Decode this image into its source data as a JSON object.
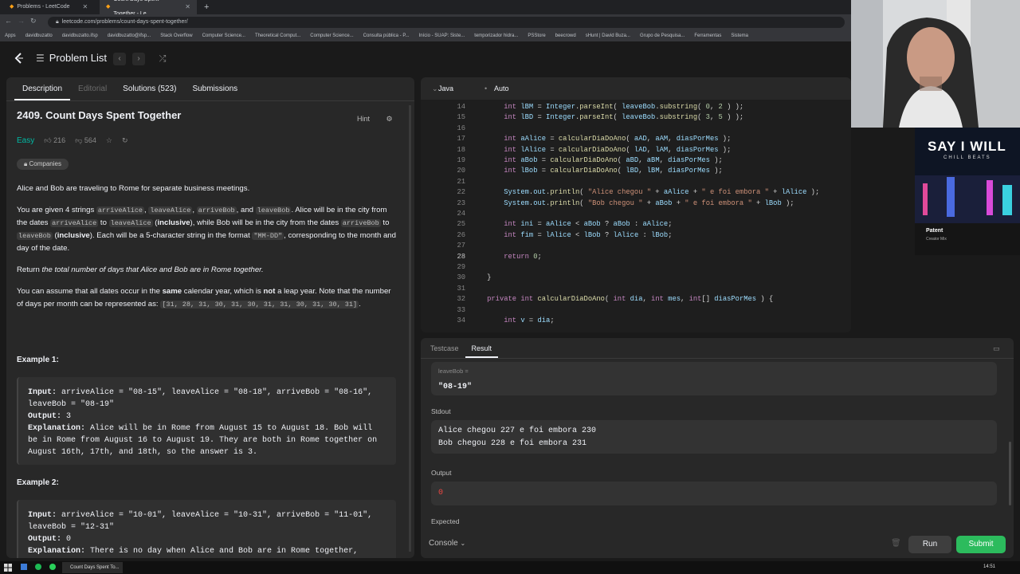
{
  "browser": {
    "tabs": [
      {
        "title": "Problems - LeetCode"
      },
      {
        "title": "Count Days Spent Together - Le"
      }
    ],
    "url": "leetcode.com/problems/count-days-spent-together/",
    "bookmarks": [
      "Apps",
      "davidbuzatto",
      "davidbuzatto.ifsp",
      "davidbuzatto@ifsp...",
      "Stack Overflow",
      "Computer Science...",
      "Theoretical Comput...",
      "Computer Science...",
      "Consulta pública - P...",
      "Início - SUAP: Siste...",
      "temporizador hidra...",
      "PSStore",
      "beecrowd",
      "sHunt | David Buza...",
      "Grupo de Pesquisa...",
      "Ferramentas",
      "Sistema"
    ]
  },
  "header": {
    "problem_list": "Problem List"
  },
  "left": {
    "tabs": [
      "Description",
      "Editorial",
      "Solutions (523)",
      "Submissions"
    ],
    "title": "2409. Count Days Spent Together",
    "hint": "Hint",
    "difficulty": "Easy",
    "likes": "216",
    "dislikes": "564",
    "companies": "Companies",
    "p1": "Alice and Bob are traveling to Rome for separate business meetings.",
    "p2_a": "You are given 4 strings ",
    "p2_c1": "arriveAlice",
    "p2_b": ", ",
    "p2_c2": "leaveAlice",
    "p2_c3": "arriveBob",
    "p2_and": ", and ",
    "p2_c4": "leaveBob",
    "p2_d": ". Alice will be in the city from the dates ",
    "p2_to": " to ",
    "p2_incl": "inclusive",
    "p2_e": "), while Bob will be in the city from the dates ",
    "p2_f": ". Each will be a 5-character string in the format ",
    "p2_fmt": "\"MM-DD\"",
    "p2_g": ", corresponding to the month and day of the date.",
    "p3_a": "Return ",
    "p3_b": "the total number of days that Alice and Bob are in Rome together.",
    "p4_a": "You can assume that all dates occur in the ",
    "p4_same": "same",
    "p4_b": " calendar year, which is ",
    "p4_not": "not",
    "p4_c": " a leap year. Note that the number of days per month can be represented as: ",
    "p4_arr": "[31, 28, 31, 30, 31, 30, 31, 31, 30, 31, 30, 31]",
    "p4_d": ".",
    "ex1_head": "Example 1:",
    "ex1_input_label": "Input:",
    "ex1_input": " arriveAlice = \"08-15\", leaveAlice = \"08-18\", arriveBob = \"08-16\", leaveBob = \"08-19\"",
    "ex1_output_label": "Output:",
    "ex1_output": " 3",
    "ex1_expl_label": "Explanation:",
    "ex1_expl": " Alice will be in Rome from August 15 to August 18. Bob will be in Rome from August 16 to August 19. They are both in Rome together on August 16th, 17th, and 18th, so the answer is 3.",
    "ex2_head": "Example 2:",
    "ex2_input_label": "Input:",
    "ex2_input": " arriveAlice = \"10-01\", leaveAlice = \"10-31\", arriveBob = \"11-01\", leaveBob = \"12-31\"",
    "ex2_output_label": "Output:",
    "ex2_output": " 0",
    "ex2_expl_label": "Explanation:",
    "ex2_expl": " There is no day when Alice and Bob are in Rome together,"
  },
  "editor": {
    "language": "Java",
    "mode": "Auto",
    "lines": [
      {
        "n": "14",
        "code": "        int lBM = Integer.parseInt( leaveBob.substring( 0, 2 ) );"
      },
      {
        "n": "15",
        "code": "        int lBD = Integer.parseInt( leaveBob.substring( 3, 5 ) );"
      },
      {
        "n": "16",
        "code": ""
      },
      {
        "n": "17",
        "code": "        int aAlice = calcularDiaDoAno( aAD, aAM, diasPorMes );"
      },
      {
        "n": "18",
        "code": "        int lAlice = calcularDiaDoAno( lAD, lAM, diasPorMes );"
      },
      {
        "n": "19",
        "code": "        int aBob = calcularDiaDoAno( aBD, aBM, diasPorMes );"
      },
      {
        "n": "20",
        "code": "        int lBob = calcularDiaDoAno( lBD, lBM, diasPorMes );"
      },
      {
        "n": "21",
        "code": ""
      },
      {
        "n": "22",
        "code": "        System.out.println( \"Alice chegou \" + aAlice + \" e foi embora \" + lAlice );"
      },
      {
        "n": "23",
        "code": "        System.out.println( \"Bob chegou \" + aBob + \" e foi embora \" + lBob );"
      },
      {
        "n": "24",
        "code": ""
      },
      {
        "n": "25",
        "code": "        int ini = aAlice < aBob ? aBob : aAlice;"
      },
      {
        "n": "26",
        "code": "        int fim = lAlice < lBob ? lAlice : lBob;"
      },
      {
        "n": "27",
        "code": ""
      },
      {
        "n": "28",
        "code": "        return 0;"
      },
      {
        "n": "29",
        "code": ""
      },
      {
        "n": "30",
        "code": "    }"
      },
      {
        "n": "31",
        "code": ""
      },
      {
        "n": "32",
        "code": "    private int calcularDiaDoAno( int dia, int mes, int[] diasPorMes ) {"
      },
      {
        "n": "33",
        "code": ""
      },
      {
        "n": "34",
        "code": "        int v = dia;"
      }
    ]
  },
  "result": {
    "tabs": [
      "Testcase",
      "Result"
    ],
    "leaveBob_label": "leaveBob =",
    "leaveBob_value": "\"08-19\"",
    "stdout_label": "Stdout",
    "stdout_line1": "Alice chegou 227 e foi embora 230",
    "stdout_line2": "Bob chegou 228 e foi embora 231",
    "output_label": "Output",
    "output_value": "0",
    "expected_label": "Expected"
  },
  "footer": {
    "console": "Console",
    "run": "Run",
    "submit": "Submit"
  },
  "overlay": {
    "music_title": "SAY I WILL",
    "music_sub": "CHILL BEATS",
    "music_channel": "Patent",
    "music_mix": "Creator Mix"
  },
  "taskbar": {
    "task": "Count Days Spent To...",
    "clock": "14:51"
  },
  "colors": {
    "easy": "#00b8a3",
    "submit": "#2cbb5d",
    "output_error": "#ef4743"
  }
}
